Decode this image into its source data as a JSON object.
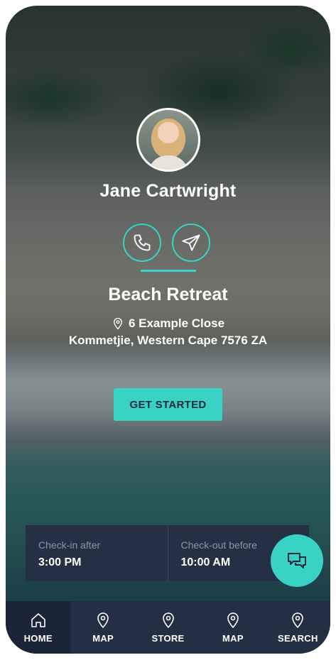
{
  "profile": {
    "name": "Jane Cartwright",
    "avatar_icon": "user-photo"
  },
  "actions": {
    "call_icon": "phone-icon",
    "message_icon": "send-icon"
  },
  "property": {
    "title": "Beach Retreat",
    "address_line1": "6 Example Close",
    "address_line2": "Kommetjie, Western Cape 7576 ZA"
  },
  "cta": {
    "label": "GET STARTED"
  },
  "checkin": {
    "label": "Check-in after",
    "value": "3:00 PM"
  },
  "checkout": {
    "label": "Check-out before",
    "value": "10:00 AM"
  },
  "chat": {
    "icon": "chat-icon"
  },
  "nav": {
    "items": [
      {
        "label": "HOME",
        "icon": "home-icon",
        "active": true
      },
      {
        "label": "MAP",
        "icon": "map-pin-icon",
        "active": false
      },
      {
        "label": "STORE",
        "icon": "map-pin-icon",
        "active": false
      },
      {
        "label": "MAP",
        "icon": "map-pin-icon",
        "active": false
      },
      {
        "label": "SEARCH",
        "icon": "map-pin-icon",
        "active": false
      }
    ]
  },
  "colors": {
    "accent": "#38d3c5",
    "panel": "#243044",
    "nav_bg": "#233044",
    "nav_active": "#1a2538"
  }
}
